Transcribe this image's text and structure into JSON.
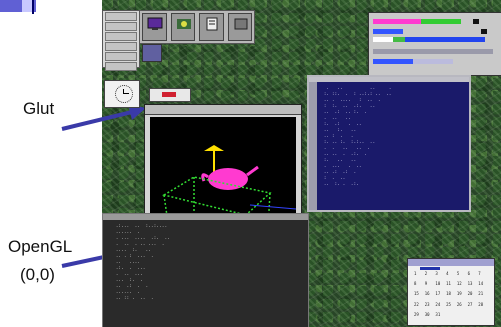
{
  "annotations": {
    "glut_label": "Glut",
    "opengl_label": "OpenGL",
    "origin_label": "(0,0)",
    "arrow_color": "#3a3aa8"
  },
  "desktop": {
    "glut_window": {
      "scene_colors": {
        "teapot": "#ff3ad0",
        "table": "#33dd33",
        "light": "#ffe000",
        "floor_line": "#3344ff"
      }
    },
    "terminal_right": {
      "lines": [
        "  .   ..          ..     .",
        " :. ::.  .  : ..:.: ..  ..",
        " .. .  ....   :  ..  .",
        " :  :.  ..  .:.   ..",
        " ..  .:  .. :.  .",
        " .  ..   ..",
        " :.  .:   .  ..",
        " ..   :.   ..",
        " .. :  .   .",
        " :. .. :.  :.:..  ..",
        " .  .   ..   ..  .",
        " .. ..  .  .:.  .",
        " :.   ..   ..",
        " .  ...   .  ..",
        " .. .:  .:  .",
        " :  .  ..",
        " ..  :. .  .:."
      ]
    },
    "terminal_bottom": {
      "lines": [
        " .:...  ..  :..:....",
        " ......  .",
        " . ...  ....  .:.  ..",
        " .  ..  . .. ...  .",
        " ....  :.   ..",
        " .. . :  ...  .",
        " ..   ....",
        " .:.  .  ...",
        " .  ..  ...",
        " ...  :.  .",
        " ..  .:  .  .",
        " ......  .",
        " .. :: .  ..  ."
      ]
    },
    "calendar": {
      "days": [
        "1",
        "2",
        "3",
        "4",
        "5",
        "6",
        "7",
        "8",
        "9",
        "10",
        "11",
        "12",
        "13",
        "14",
        "15",
        "16",
        "17",
        "18",
        "19",
        "20",
        "21",
        "22",
        "23",
        "24",
        "25",
        "26",
        "27",
        "28",
        "29",
        "30",
        "31"
      ]
    }
  }
}
